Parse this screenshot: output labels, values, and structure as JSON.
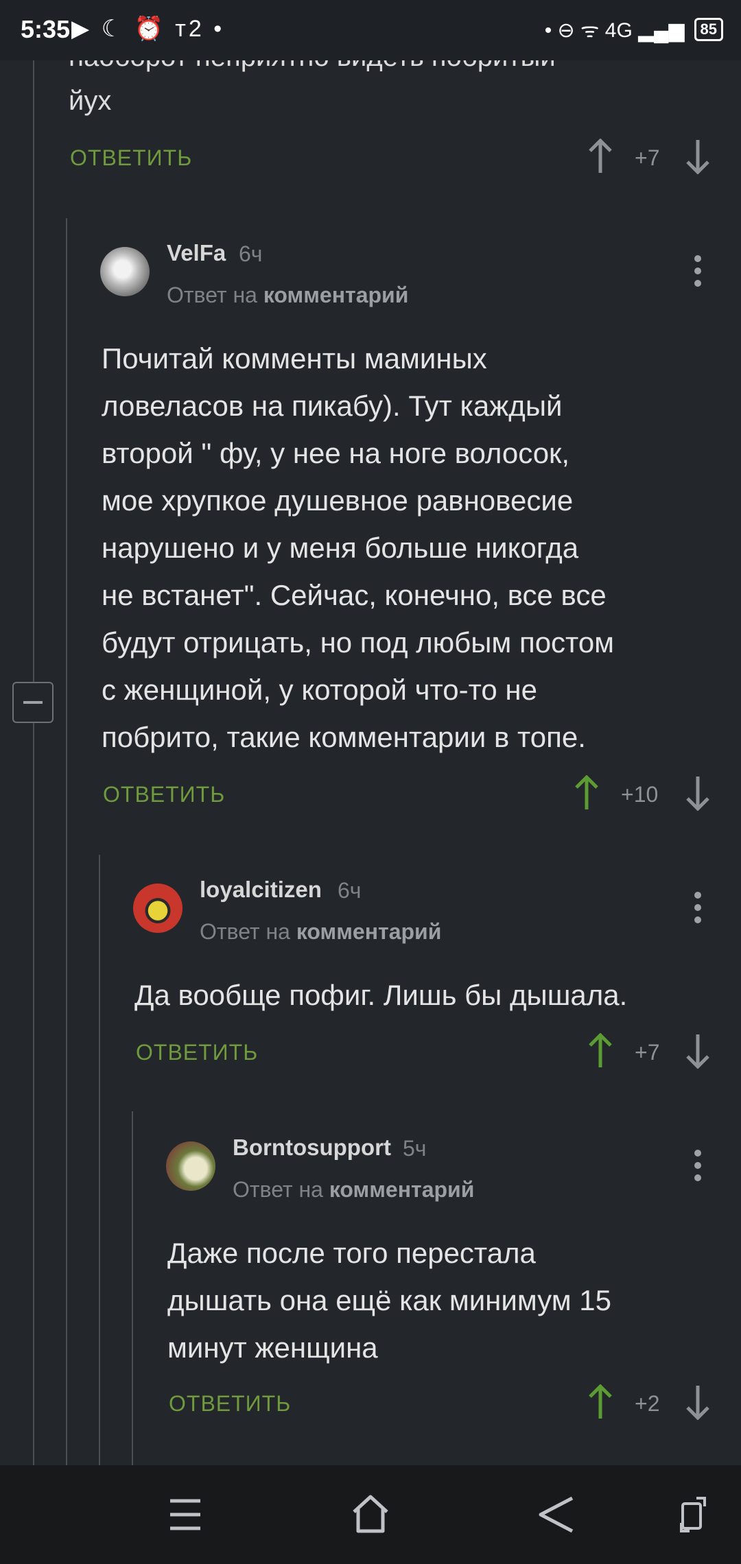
{
  "status_bar": {
    "time": "5:35",
    "left_icons": "▶ ☾ ⏰ т2 •",
    "right_icons": "• ⊖ ᯤ 4G ▂▄▆",
    "battery": "85"
  },
  "top_comment": {
    "partial_line": "наоборот неприятно видеть побритый",
    "last_line": "йух",
    "reply_label": "ОТВЕТИТЬ",
    "score": "+7"
  },
  "comments": [
    {
      "author": "VelFa",
      "ago": "6ч",
      "reply_prefix": "Ответ на",
      "reply_link": "комментарий",
      "lines": [
        "Почитай комменты маминых",
        "ловеласов на пикабу). Тут каждый",
        "второй \" фу, у нее на ноге волосок,",
        "мое хрупкое душевное равновесие",
        "нарушено и у меня больше никогда",
        "не встанет\". Сейчас, конечно, все все",
        "будут отрицать, но под любым постом",
        "с женщиной, у которой что-то не",
        "побрито, такие комментарии в топе."
      ],
      "reply_label": "ОТВЕТИТЬ",
      "score": "+10"
    },
    {
      "author": "loyalcitizen",
      "ago": "6ч",
      "reply_prefix": "Ответ на",
      "reply_link": "комментарий",
      "lines": [
        "Да вообще пофиг. Лишь бы дышала."
      ],
      "reply_label": "ОТВЕТИТЬ",
      "score": "+7"
    },
    {
      "author": "Borntosupport",
      "ago": "5ч",
      "reply_prefix": "Ответ на",
      "reply_link": "комментарий",
      "lines": [
        "Даже после того перестала",
        "дышать она ещё как минимум 15",
        "минут женщина"
      ],
      "reply_label": "ОТВЕТИТЬ",
      "score": "+2"
    }
  ],
  "colors": {
    "background": "#23272b",
    "accent_green": "#6f9a3d",
    "upvote_active": "#5d9b33",
    "muted": "#8d9296"
  },
  "nav_icons": [
    "menu-icon",
    "home-icon",
    "back-icon",
    "rotate-icon"
  ]
}
